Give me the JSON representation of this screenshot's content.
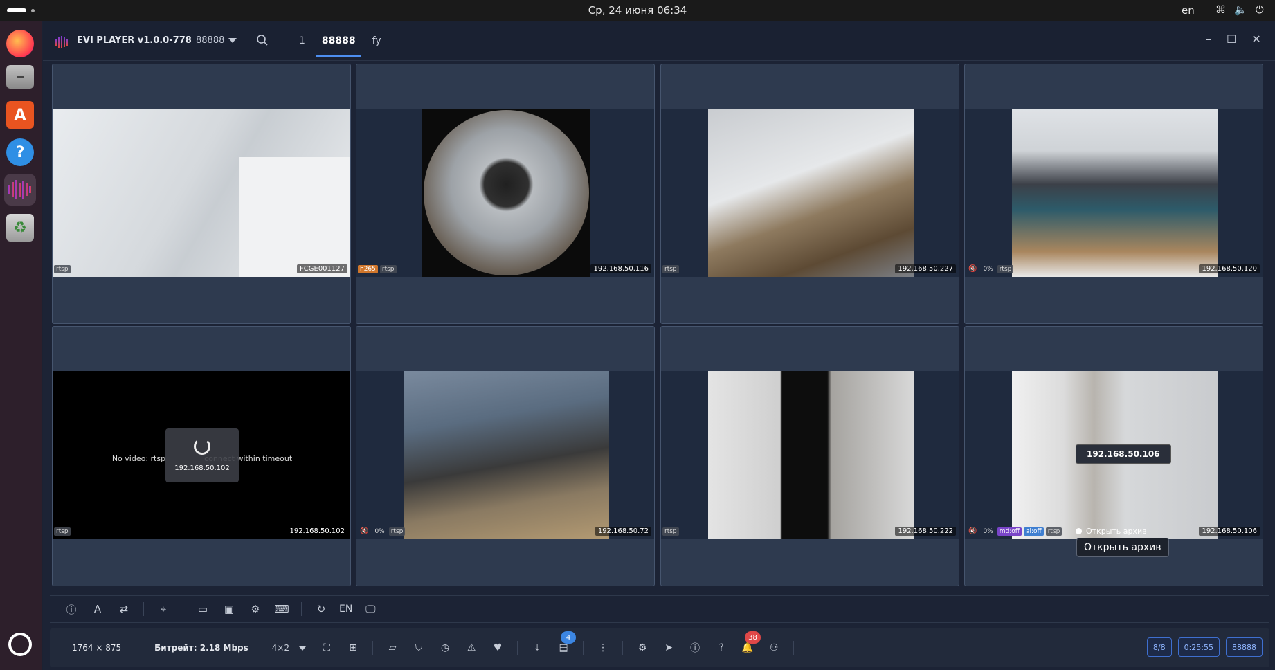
{
  "topbar": {
    "clock": "Ср, 24 июня  06:34",
    "language": "en",
    "tray_icons": [
      "network-icon",
      "volume-icon",
      "power-icon"
    ]
  },
  "dock": {
    "items": [
      {
        "name": "firefox-icon",
        "color": "#ff7139"
      },
      {
        "name": "files-icon",
        "color": "#b9b9b9"
      },
      {
        "name": "app-center-icon",
        "color": "#e95420"
      },
      {
        "name": "help-icon",
        "color": "#2e86de"
      },
      {
        "name": "evi-player-icon",
        "color": "#a040d0"
      },
      {
        "name": "trash-icon",
        "color": "#5fa35f"
      },
      {
        "name": "ubuntu-apps-icon",
        "color": "#ffffff"
      }
    ]
  },
  "window": {
    "app_name": "EVI PLAYER v1.0.0-778",
    "profile": "88888",
    "tabs": [
      "1",
      "88888",
      "fy"
    ],
    "active_tab": 1
  },
  "cameras": [
    {
      "ip": "FCGE001127",
      "badges": [
        "rtsp"
      ],
      "scene": "wall"
    },
    {
      "ip": "192.168.50.116",
      "badges": [
        "h265",
        "rtsp"
      ],
      "scene": "fisheye"
    },
    {
      "ip": "192.168.50.227",
      "badges": [
        "rtsp"
      ],
      "scene": "room"
    },
    {
      "ip": "192.168.50.120",
      "badges": [
        "vol",
        "0%",
        "rtsp"
      ],
      "scene": "office"
    },
    {
      "ip": "192.168.50.102",
      "badges": [
        "rtsp"
      ],
      "scene": "none"
    },
    {
      "ip": "192.168.50.72",
      "badges": [
        "vol",
        "0%",
        "rtsp"
      ],
      "scene": "desk"
    },
    {
      "ip": "192.168.50.222",
      "badges": [
        "rtsp"
      ],
      "scene": "hall"
    },
    {
      "ip": "192.168.50.106",
      "badges": [
        "vol",
        "0%",
        "md:off",
        "ai:off",
        "rtsp"
      ],
      "scene": "camera"
    }
  ],
  "overlays": {
    "no_video": "No video: rtsp",
    "no_video_tail": "connect within timeout",
    "loading_ip": "192.168.50.102",
    "hover_ip": "192.168.50.106",
    "archive_button": "Открыть архив",
    "archive_tooltip": "Открыть архив"
  },
  "toolbar": {
    "language": "EN",
    "icons": [
      "info-icon",
      "ai-text-icon",
      "swap-icon",
      "location-icon",
      "monitor-icon",
      "image-icon",
      "settings-icon",
      "keyboard-icon",
      "refresh-icon",
      "display-icon"
    ]
  },
  "statusbar": {
    "resolution": "1764 × 875",
    "bitrate": "Битрейт: 2.18 Mbps",
    "layout": "4×2",
    "download_count": "4",
    "alerts_count": "38",
    "pill_streams": "8/8",
    "pill_time": "0:25:55",
    "pill_profile": "88888"
  }
}
